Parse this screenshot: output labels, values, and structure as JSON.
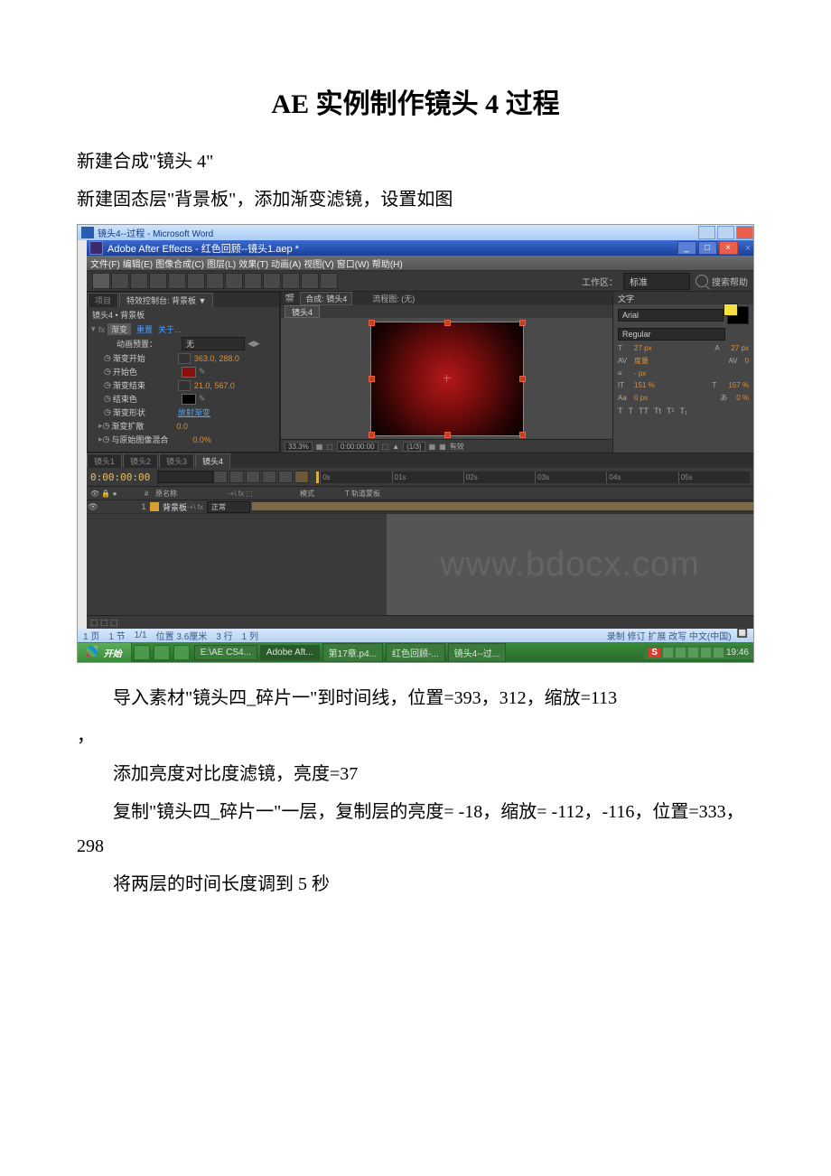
{
  "doc": {
    "title": "AE 实例制作镜头 4 过程",
    "p1": "新建合成\"镜头 4\"",
    "p2": "新建固态层\"背景板\"，添加渐变滤镜，设置如图",
    "p3": "导入素材\"镜头四_碎片一\"到时间线，位置=393，312，缩放=113",
    "p3b": "，",
    "p4": "添加亮度对比度滤镜，亮度=37",
    "p5": "复制\"镜头四_碎片一\"一层，复制层的亮度= -18，缩放= -112，-116，位置=333，298",
    "p6": "将两层的时间长度调到 5 秒"
  },
  "word": {
    "title": "镜头4--过程 - Microsoft Word",
    "status": {
      "page": "1 页",
      "section": "1 节",
      "pages": "1/1",
      "pos": "位置 3.6厘米",
      "line": "3 行",
      "col": "1 列",
      "mode": "录制 修订 扩展 改写 中文(中国)"
    }
  },
  "ae": {
    "title": "Adobe After Effects - 红色回顾--镜头1.aep *",
    "menu": [
      "文件(F)",
      "编辑(E)",
      "图像合成(C)",
      "图层(L)",
      "效果(T)",
      "动画(A)",
      "视图(V)",
      "窗口(W)",
      "帮助(H)"
    ],
    "workspace_label": "工作区：",
    "workspace_value": "标准",
    "search": "搜索帮助",
    "panels": {
      "project": "项目",
      "effect_controls": "特效控制台: 背景板",
      "comp_header": "镜头4 • 背景板",
      "effect_name": "渐变",
      "reset": "重置",
      "about": "关于...",
      "anim_preset_label": "动画预置：",
      "anim_preset_value": "无",
      "props": {
        "ramp_start": {
          "label": "渐变开始",
          "value": "363.0, 288.0"
        },
        "start_color": {
          "label": "开始色"
        },
        "ramp_end": {
          "label": "渐变结束",
          "value": "21.0, 567.0"
        },
        "end_color": {
          "label": "结束色"
        },
        "ramp_shape": {
          "label": "渐变形状",
          "value": "放射渐变"
        },
        "ramp_scatter": {
          "label": "渐变扩散",
          "value": "0.0"
        },
        "blend": {
          "label": "与原始图像混合",
          "value": "0.0%"
        }
      }
    },
    "viewer": {
      "comp_label": "合成: 镜头4",
      "flow_label": "流程图: (无)",
      "subtab": "镜头4",
      "zoom": "33.3%",
      "res": "(1/3)",
      "time": "0:00:00:00"
    },
    "char": {
      "title": "文字",
      "font": "Arial",
      "style": "Regular",
      "size": "27 px",
      "leading": "27 px",
      "kerning": "度量",
      "tracking": "0",
      "stroke": "- px",
      "vscale": "151 %",
      "hscale": "157 %",
      "baseline": "0 px",
      "tsume": "0 %"
    },
    "timeline": {
      "tabs": [
        "镜头1",
        "镜头2",
        "镜头3",
        "镜头4"
      ],
      "timecode": "0:00:00:00",
      "col_source": "原名称",
      "col_mode": "模式",
      "col_trkmat": "T 轨道蒙板",
      "layer": {
        "num": "1",
        "name": "背景板",
        "mode": "正常"
      },
      "ticks": [
        "0s",
        "01s",
        "02s",
        "03s",
        "04s",
        "05s"
      ]
    }
  },
  "taskbar": {
    "start": "开始",
    "apps": [
      "E:\\AE CS4...",
      "Adobe Aft...",
      "第17章.p4...",
      "红色回顾-...",
      "镜头4--过..."
    ],
    "tray_badge": "S",
    "time": "19:46"
  },
  "watermark": "www.bdocx.com"
}
